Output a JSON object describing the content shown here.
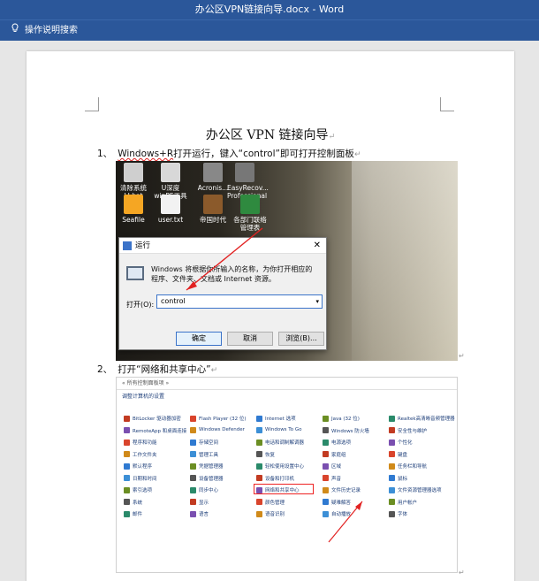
{
  "window": {
    "title": "办公区VPN链接向导.docx  -  Word"
  },
  "ribbon": {
    "tell_me": "操作说明搜索"
  },
  "doc": {
    "title": "办公区 VPN 链接向导",
    "step1": {
      "num": "1、",
      "text_pre": "Windows+R",
      "text_post": "打开运行，键入“control”即可打开控制面板"
    },
    "step2": {
      "num": "2、",
      "text": "打开“网络和共享中心”"
    },
    "para_mark": "↵"
  },
  "shot1": {
    "desktop_icons": [
      {
        "label": "清除系统LJ.bat",
        "color": "#cfcfcf"
      },
      {
        "label": "U深度winPE工具",
        "color": "#d8d8d8"
      },
      {
        "label": "Acronis...",
        "color": "#888"
      },
      {
        "label": "EasyRecov... Professional",
        "color": "#777"
      },
      {
        "label": "Seafile",
        "color": "#f5a623"
      },
      {
        "label": "user.txt",
        "color": "#f2f2f2"
      },
      {
        "label": "帝国时代",
        "color": "#8b5a2b"
      },
      {
        "label": "各部门联络管理表",
        "color": "#2f8a3f"
      }
    ],
    "run": {
      "title": "运行",
      "description": "Windows 将根据你所输入的名称，为你打开相应的程序、文件夹、文档或 Internet 资源。",
      "open_label": "打开(O):",
      "input_value": "control",
      "ok": "确定",
      "cancel": "取消",
      "browse": "浏览(B)..."
    }
  },
  "shot2": {
    "address": "« 所有控制面板项 »",
    "heading": "调整计算机的设置",
    "items": [
      "BitLocker 驱动器加密",
      "Flash Player (32 位)",
      "Internet 选项",
      "Java (32 位)",
      "Realtek高清晰音频管理器",
      "RemoteApp 和桌面连接",
      "Windows Defender",
      "Windows To Go",
      "Windows 防火墙",
      "安全性与维护",
      "程序和功能",
      "存储空间",
      "电话和调制解调器",
      "电源选项",
      "个性化",
      "工作文件夹",
      "管理工具",
      "恢复",
      "家庭组",
      "键盘",
      "默认程序",
      "凭据管理器",
      "轻松使用设置中心",
      "区域",
      "任务栏和导航",
      "日期和时间",
      "设备管理器",
      "设备和打印机",
      "声音",
      "鼠标",
      "索引选项",
      "同步中心",
      "网络和共享中心",
      "文件历史记录",
      "文件资源管理器选项",
      "系统",
      "显示",
      "颜色管理",
      "疑难解答",
      "用户帐户",
      "邮件",
      "语言",
      "语音识别",
      "自动播放",
      "字体"
    ],
    "highlight": "网络和共享中心"
  },
  "colors": {
    "accent": "#2b579a",
    "arrow": "#e22222"
  }
}
